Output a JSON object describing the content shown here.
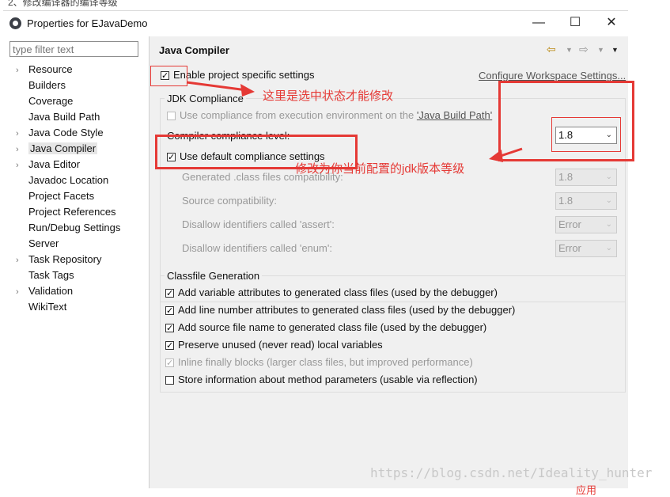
{
  "top_fragment": "2、修改编译器的编译等级",
  "window": {
    "title": "Properties for EJavaDemo",
    "minimize": "—",
    "maximize": "☐",
    "close": "✕"
  },
  "sidebar": {
    "filter_placeholder": "type filter text",
    "items": [
      {
        "label": "Resource",
        "expandable": true
      },
      {
        "label": "Builders",
        "expandable": false
      },
      {
        "label": "Coverage",
        "expandable": false
      },
      {
        "label": "Java Build Path",
        "expandable": false
      },
      {
        "label": "Java Code Style",
        "expandable": true
      },
      {
        "label": "Java Compiler",
        "expandable": true,
        "selected": true
      },
      {
        "label": "Java Editor",
        "expandable": true
      },
      {
        "label": "Javadoc Location",
        "expandable": false
      },
      {
        "label": "Project Facets",
        "expandable": false
      },
      {
        "label": "Project References",
        "expandable": false
      },
      {
        "label": "Run/Debug Settings",
        "expandable": false
      },
      {
        "label": "Server",
        "expandable": false
      },
      {
        "label": "Task Repository",
        "expandable": true
      },
      {
        "label": "Task Tags",
        "expandable": false
      },
      {
        "label": "Validation",
        "expandable": true
      },
      {
        "label": "WikiText",
        "expandable": false
      }
    ]
  },
  "main": {
    "title": "Java Compiler",
    "enable_specific": "Enable project specific settings",
    "configure_link": "Configure Workspace Settings...",
    "jdk": {
      "group_title": "JDK Compliance",
      "use_env": "Use compliance from execution environment on the ",
      "use_env_link": "'Java Build Path'",
      "compliance_level_label": "Compiler compliance level:",
      "compliance_level_value": "1.8",
      "use_default": "Use default compliance settings",
      "generated_label": "Generated .class files compatibility:",
      "generated_value": "1.8",
      "source_label": "Source compatibility:",
      "source_value": "1.8",
      "assert_label": "Disallow identifiers called 'assert':",
      "assert_value": "Error",
      "enum_label": "Disallow identifiers called 'enum':",
      "enum_value": "Error"
    },
    "classfile": {
      "group_title": "Classfile Generation",
      "opts": [
        {
          "label": "Add variable attributes to generated class files (used by the debugger)",
          "checked": true,
          "disabled": false
        },
        {
          "label": "Add line number attributes to generated class files (used by the debugger)",
          "checked": true,
          "disabled": false
        },
        {
          "label": "Add source file name to generated class file (used by the debugger)",
          "checked": true,
          "disabled": false
        },
        {
          "label": "Preserve unused (never read) local variables",
          "checked": true,
          "disabled": false
        },
        {
          "label": "Inline finally blocks (larger class files, but improved performance)",
          "checked": true,
          "disabled": true
        },
        {
          "label": "Store information about method parameters (usable via reflection)",
          "checked": false,
          "disabled": false
        }
      ]
    }
  },
  "annotations": {
    "note_enable": "这里是选中状态才能修改",
    "note_version": "修改为你当前配置的jdk版本等级",
    "bottom_fragment": "应用"
  },
  "watermark": "https://blog.csdn.net/Ideality_hunter",
  "colors": {
    "annotation": "#e53935",
    "pane_bg": "#f0f0f0",
    "selection": "#e5e5e5"
  }
}
